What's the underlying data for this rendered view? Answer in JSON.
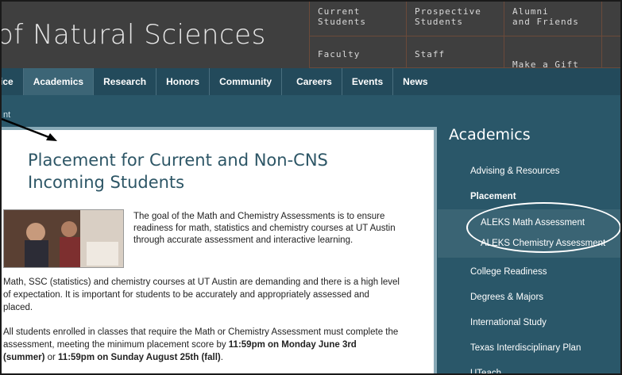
{
  "header": {
    "site_title": "of Natural Sciences",
    "top_links": [
      {
        "label": "Current\nStudents"
      },
      {
        "label": "Prospective\nStudents"
      },
      {
        "label": "Alumni\nand Friends"
      },
      {
        "label": "Faculty"
      },
      {
        "label": "Staff"
      },
      {
        "label": "Make a Gift"
      }
    ]
  },
  "nav": {
    "items": [
      "ffice",
      "Academics",
      "Research",
      "Honors",
      "Community",
      "Careers",
      "Events",
      "News"
    ],
    "active": "Academics"
  },
  "breadcrumb": "nt",
  "content": {
    "title": "Placement for Current and Non-CNS Incoming Students",
    "intro": "The goal of the Math and Chemistry Assessments is to ensure readiness for math, statistics and chemistry courses at UT Austin through accurate assessment and interactive learning.",
    "para1": "Math, SSC (statistics) and chemistry courses at UT Austin are demanding and there is a high level of expectation.  It is important for students to be accurately and appropriately assessed and placed.",
    "para2_start": "All students enrolled in classes that require the Math or Chemistry Assessment must complete the assessment, meeting the minimum placement score by ",
    "deadline_summer": "11:59pm on Monday June 3rd (summer)",
    "para2_or": " or ",
    "deadline_fall": "11:59pm on Sunday August 25th (fall)",
    "para2_end": "."
  },
  "sidebar": {
    "title": "Academics",
    "items": [
      {
        "label": "Advising & Resources"
      },
      {
        "label": "Placement"
      },
      {
        "label": "ALEKS Math Assessment"
      },
      {
        "label": "ALEKS Chemistry Assessment"
      },
      {
        "label": "College Readiness"
      },
      {
        "label": "Degrees & Majors"
      },
      {
        "label": "International Study"
      },
      {
        "label": "Texas Interdisciplinary Plan"
      },
      {
        "label": "UTeach"
      }
    ]
  },
  "colors": {
    "header_bg": "#3f3f3f",
    "nav_bg": "#234a5b",
    "page_bg": "#2a5769",
    "title_color": "#2d5666",
    "gift_icon": "#e08a2c"
  },
  "icons": [
    "gift-icon",
    "arrow-annotation-icon",
    "oval-annotation-icon"
  ]
}
